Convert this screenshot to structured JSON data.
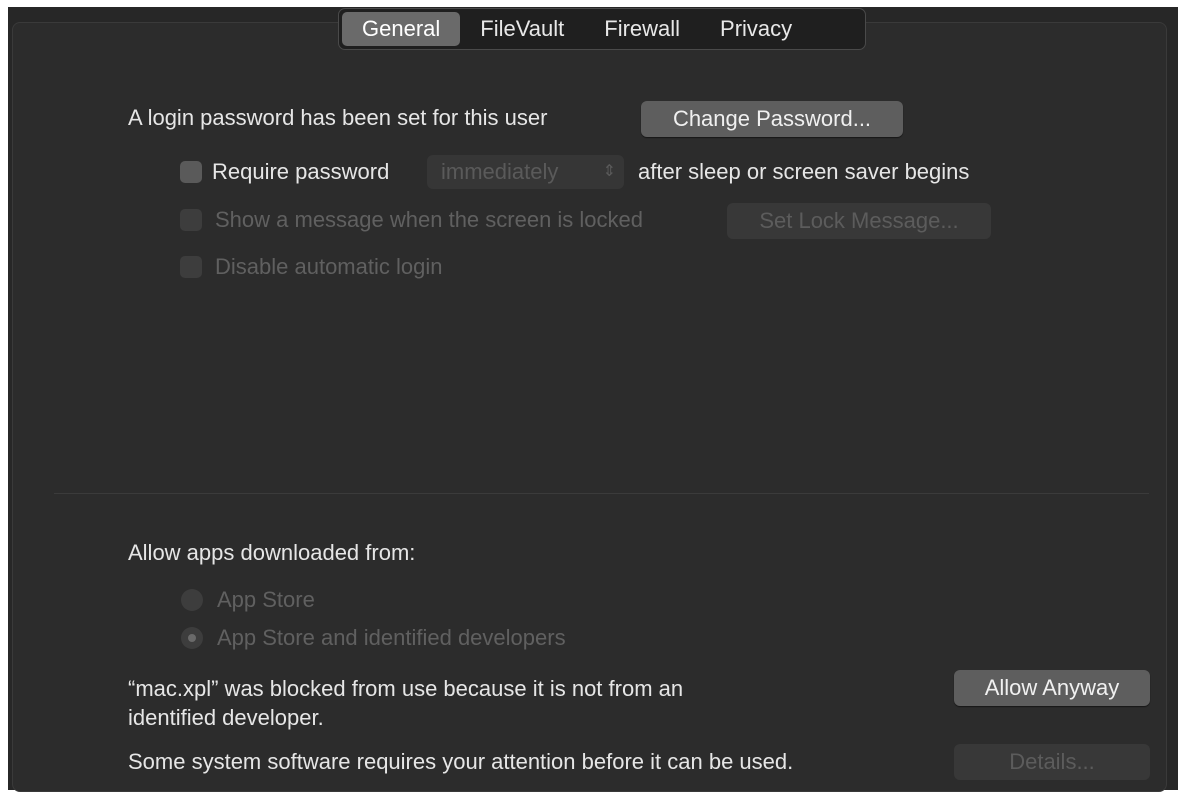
{
  "tabs": [
    {
      "label": "General",
      "selected": true
    },
    {
      "label": "FileVault",
      "selected": false
    },
    {
      "label": "Firewall",
      "selected": false
    },
    {
      "label": "Privacy",
      "selected": false
    }
  ],
  "general": {
    "password_status": "A login password has been set for this user",
    "change_password_button": "Change Password...",
    "require_password": {
      "label": "Require password",
      "checked": false,
      "delay_value": "immediately",
      "suffix": "after sleep or screen saver begins"
    },
    "show_message": {
      "label": "Show a message when the screen is locked",
      "checked": false,
      "enabled": false
    },
    "set_lock_message_button": "Set Lock Message...",
    "disable_auto_login": {
      "label": "Disable automatic login",
      "checked": false,
      "enabled": false
    }
  },
  "downloads": {
    "heading": "Allow apps downloaded from:",
    "options": [
      {
        "label": "App Store",
        "selected": false
      },
      {
        "label": "App Store and identified developers",
        "selected": true
      }
    ],
    "blocked_message_line1": "“mac.xpl” was blocked from use because it is not from an",
    "blocked_message_line2": "identified developer.",
    "allow_anyway_button": "Allow Anyway",
    "system_software_message": "Some system software requires your attention before it can be used.",
    "details_button": "Details..."
  },
  "colors": {
    "background": "#2c2c2c",
    "selected_tab": "#6a6a6a",
    "text": "#e6e6e6",
    "disabled_text": "#606060"
  }
}
